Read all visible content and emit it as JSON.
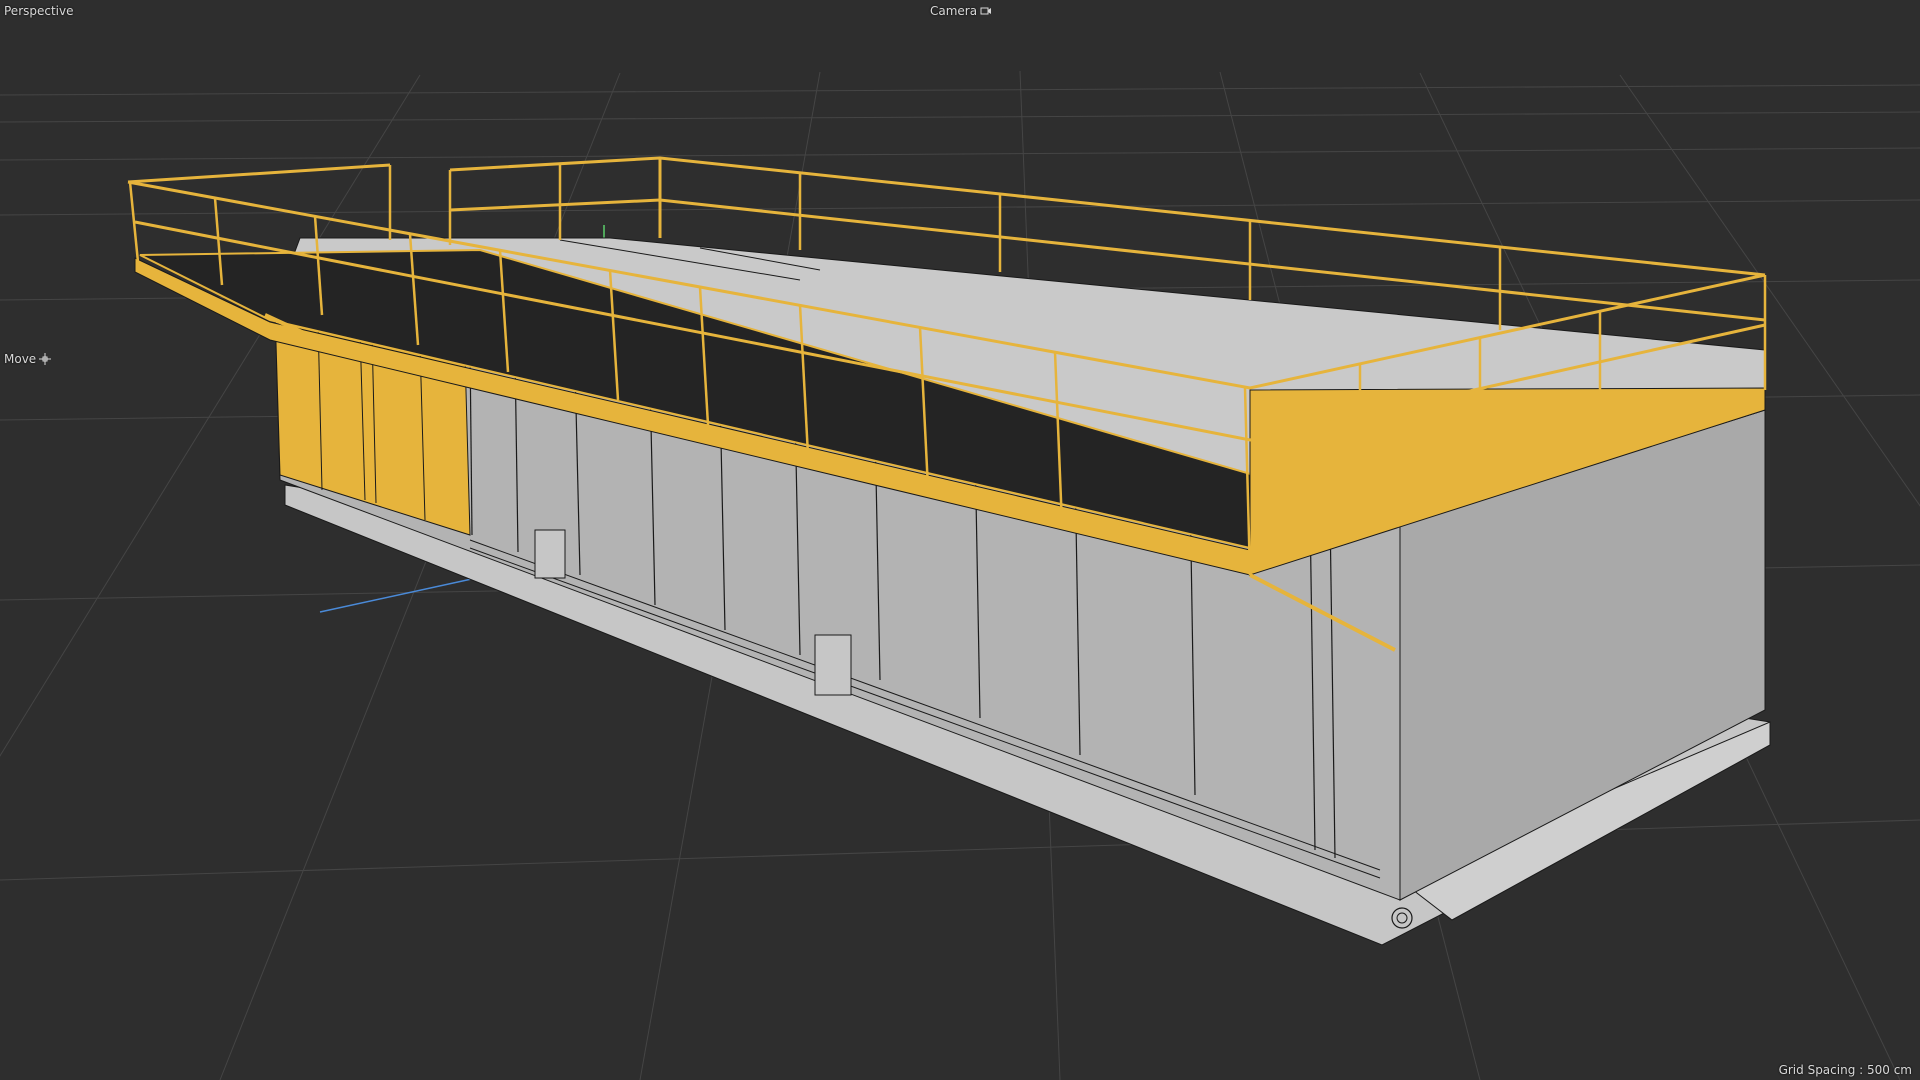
{
  "viewport": {
    "view_name": "Perspective",
    "camera_label": "Camera",
    "camera_icon": "camera-icon",
    "tool_label": "Move",
    "tool_icon": "move-icon",
    "grid_spacing": "Grid Spacing : 500 cm"
  },
  "colors": {
    "background": "#2e2e2e",
    "grid": "#454545",
    "model_gray": "#b3b3b3",
    "model_light": "#c6c6c6",
    "selection_yellow": "#e6b43c",
    "wire": "#1a1a1a",
    "axis_blue": "#4a8ad8",
    "axis_green": "#5ccf6a"
  }
}
